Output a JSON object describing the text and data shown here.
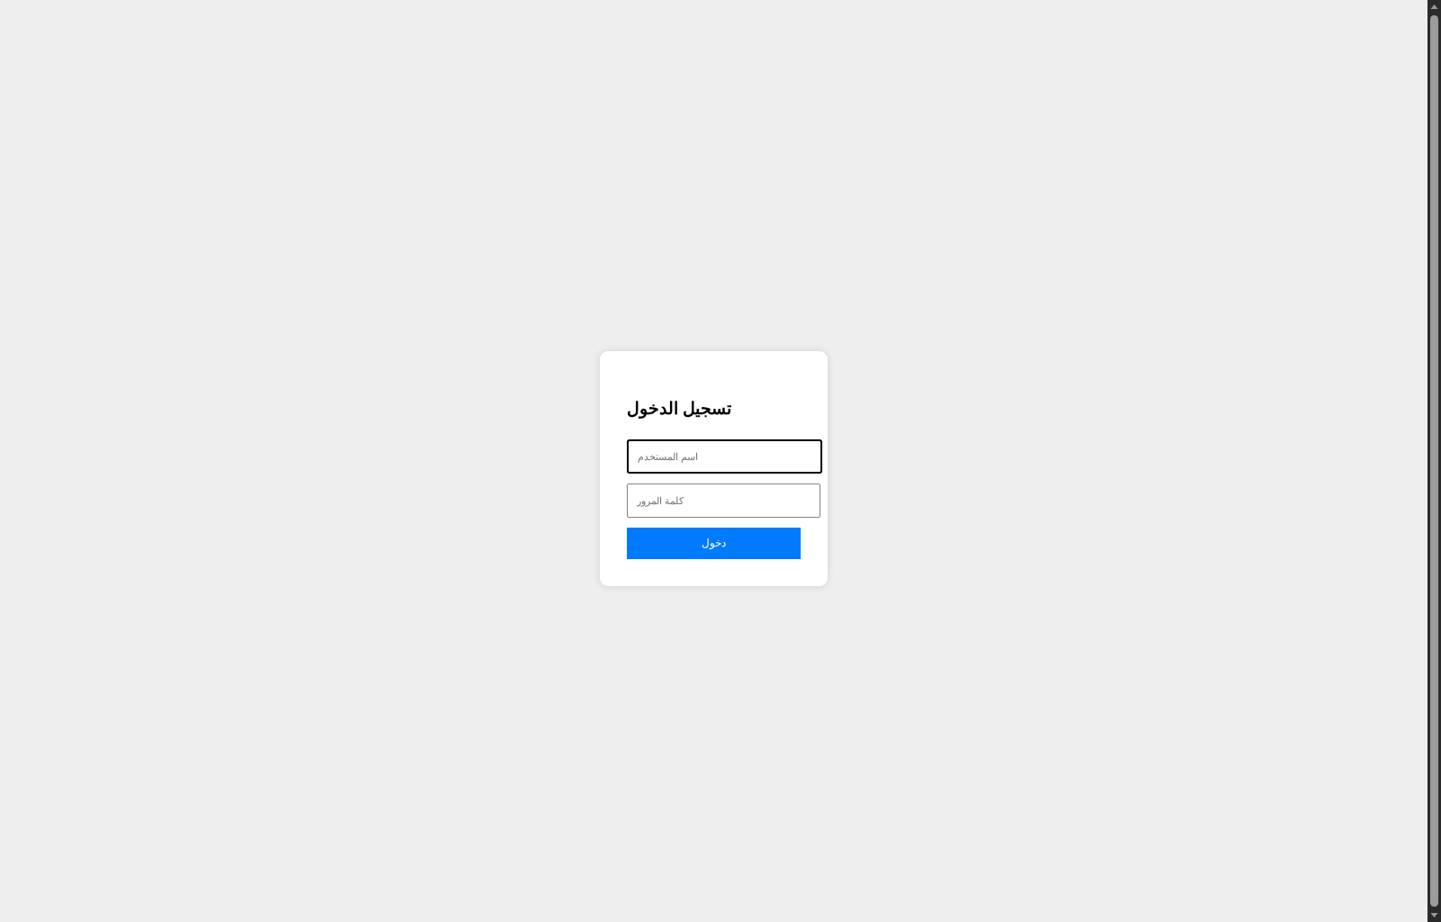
{
  "login_form": {
    "title": "تسجيل الدخول",
    "fields": [
      {
        "placeholder": "اسم المستخدم",
        "focused": true
      },
      {
        "placeholder": "كلمة المرور",
        "focused": false
      }
    ],
    "submit_button": "دخول"
  }
}
